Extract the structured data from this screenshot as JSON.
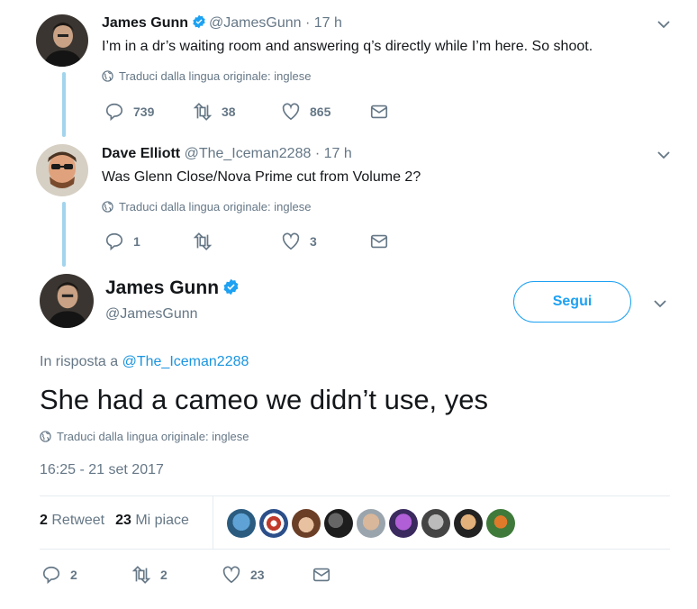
{
  "tweets": [
    {
      "name": "James Gunn",
      "handle": "@JamesGunn",
      "time": "· 17 h",
      "text": "I’m in a dr’s waiting room and answering q’s directly while I’m here. So shoot.",
      "translate": "Traduci dalla lingua originale: inglese",
      "replies": "739",
      "retweets": "38",
      "likes": "865"
    },
    {
      "name": "Dave Elliott",
      "handle": "@The_Iceman2288",
      "time": "· 17 h",
      "text": "Was Glenn Close/Nova Prime cut from Volume 2?",
      "translate": "Traduci dalla lingua originale: inglese",
      "replies": "1",
      "retweets": "",
      "likes": "3"
    }
  ],
  "main_tweet": {
    "name": "James Gunn",
    "handle": "@JamesGunn",
    "follow_label": "Segui",
    "reply_prefix": "In risposta a",
    "reply_to": "@The_Iceman2288",
    "text": "She had a cameo we didn’t use, yes",
    "translate": "Traduci dalla lingua originale: inglese",
    "timestamp": "16:25 - 21 set 2017",
    "retweet_count": "2",
    "retweet_label": "Retweet",
    "like_count": "23",
    "like_label": "Mi piace",
    "replies": "2",
    "retweets": "2",
    "likes": "23"
  },
  "icons": [
    "reply-icon",
    "retweet-icon",
    "like-icon",
    "message-icon",
    "globe-icon",
    "chevron-down-icon",
    "verified-badge-icon"
  ],
  "colors": {
    "accent": "#1da1f2",
    "muted": "#657786",
    "thread": "#a3d4ed"
  }
}
